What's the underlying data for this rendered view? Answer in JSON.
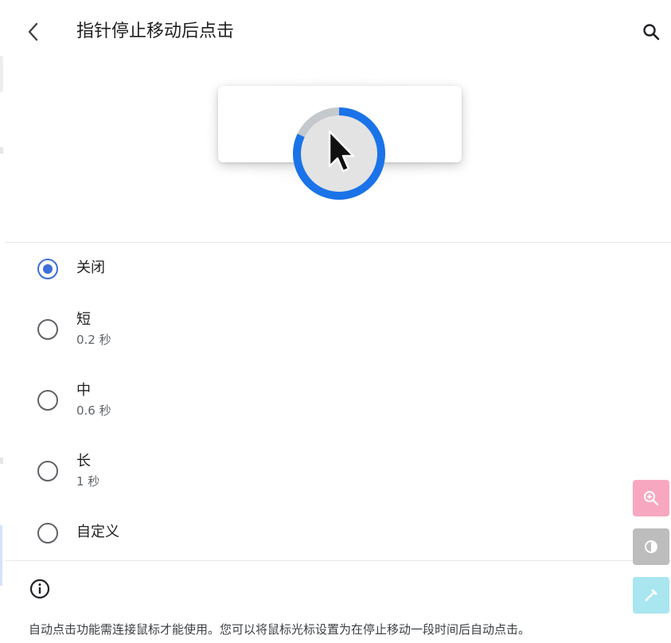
{
  "header": {
    "title": "指针停止移动后点击",
    "back_icon": "chevron-left-icon",
    "search_icon": "search-icon"
  },
  "illustration": {
    "icon": "cursor-dwell-ring-icon",
    "ring_progress_fraction": 0.82,
    "ring_color": "#1a73e8",
    "ring_track_color": "#c5c8cc"
  },
  "options": [
    {
      "label": "关闭",
      "sub": "",
      "checked": true
    },
    {
      "label": "短",
      "sub": "0.2 秒",
      "checked": false
    },
    {
      "label": "中",
      "sub": "0.6 秒",
      "checked": false
    },
    {
      "label": "长",
      "sub": "1 秒",
      "checked": false
    },
    {
      "label": "自定义",
      "sub": "",
      "checked": false
    }
  ],
  "footer": {
    "info_icon": "info-icon",
    "text": "自动点击功能需连接鼠标才能使用。您可以将鼠标光标设置为在停止移动一段时间后自动点击。"
  },
  "floating_tools": [
    {
      "icon": "zoom-in-icon",
      "color": "#f7a8c0"
    },
    {
      "icon": "contrast-icon",
      "color": "#bdbdbd"
    },
    {
      "icon": "color-picker-icon",
      "color": "#a9e6ef"
    }
  ],
  "colors": {
    "accent": "#3f6fd8",
    "text_primary": "#1f1f1f",
    "text_secondary": "#5f6368"
  }
}
